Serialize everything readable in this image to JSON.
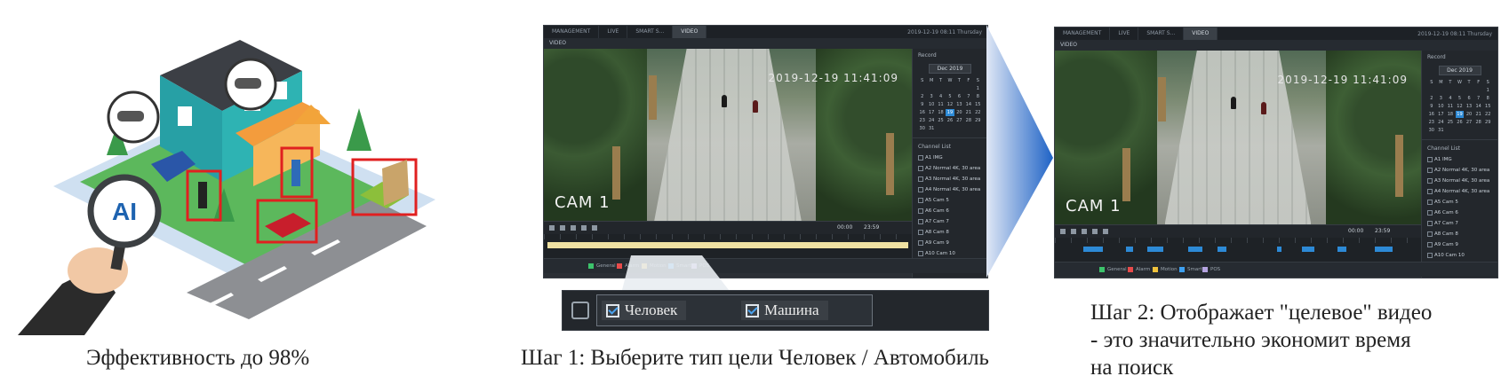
{
  "captions": {
    "left": "Эффективность до 98%",
    "middle": "Шаг 1: Выберите тип цели Человек / Автомобиль",
    "right_line1": "Шаг 2: Отображает \"целевое\" видео",
    "right_line2": "- это значительно экономит время",
    "right_line3": "на поиск"
  },
  "illustration": {
    "magnifier_label": "AI"
  },
  "player": {
    "tabs": [
      "MANAGEMENT",
      "LIVE",
      "SMART S...",
      "VIDEO"
    ],
    "window_title": "VIDEO",
    "clock": "2019-12-19 08:11 Thursday",
    "camera_label": "CAM 1",
    "osd_timestamp": "2019-12-19 11:41:09",
    "side_title": "Record",
    "date_selector": "Dec 2019",
    "weekdays": [
      "S",
      "M",
      "T",
      "W",
      "T",
      "F",
      "S"
    ],
    "calendar_days": [
      "",
      "",
      "",
      "",
      "",
      "",
      "1",
      "2",
      "3",
      "4",
      "5",
      "6",
      "7",
      "8",
      "9",
      "10",
      "11",
      "12",
      "13",
      "14",
      "15",
      "16",
      "17",
      "18",
      "19",
      "20",
      "21",
      "22",
      "23",
      "24",
      "25",
      "26",
      "27",
      "28",
      "29",
      "30",
      "31",
      "",
      "",
      ""
    ],
    "selected_day": "19",
    "channel_header": "Channel List",
    "channels": [
      "A1 IMG",
      "A2 Normal 4K, 30 area",
      "A3 Normal 4K, 30 area",
      "A4 Normal 4K, 30 area",
      "A5 Cam 5",
      "A6 Cam 6",
      "A7 Cam 7",
      "A8 Cam 8",
      "A9 Cam 9",
      "A10 Cam 10"
    ],
    "time_from": "00:00",
    "time_to": "23:59",
    "legend": [
      "General",
      "Alarm",
      "Motion",
      "Smart",
      "POS"
    ],
    "colors": {
      "general": "#3cc36b",
      "alarm": "#e84b4b",
      "motion": "#f0c23c",
      "smart": "#3ea0f0",
      "pos": "#b5a4e0"
    }
  },
  "filter": {
    "options": [
      {
        "label": "Человек",
        "checked": true
      },
      {
        "label": "Машина",
        "checked": true
      }
    ]
  }
}
